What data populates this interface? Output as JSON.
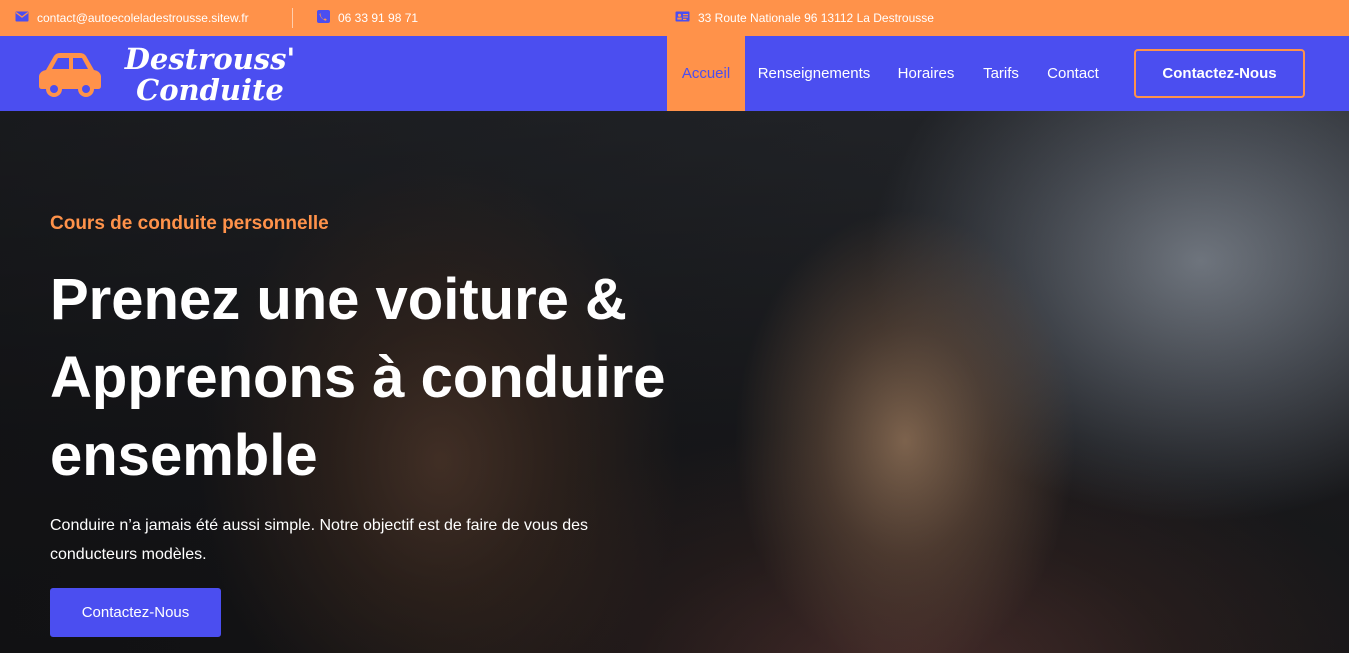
{
  "colors": {
    "accent_orange": "#FF924A",
    "brand_blue": "#4B4EF0"
  },
  "topbar": {
    "email": "contact@autoecoleladestrousse.sitew.fr",
    "email_icon": "mail-icon",
    "phone": "06 33 91 98 71",
    "phone_icon": "phone-icon",
    "address": "33 Route Nationale 96 13112 La Destrousse",
    "address_icon": "address-card-icon"
  },
  "logo": {
    "line1": "Destrouss'",
    "line2": "Conduite",
    "icon": "car-icon"
  },
  "nav": {
    "items": [
      {
        "label": "Accueil",
        "active": true
      },
      {
        "label": "Renseignements",
        "active": false
      },
      {
        "label": "Horaires",
        "active": false
      },
      {
        "label": "Tarifs",
        "active": false
      },
      {
        "label": "Contact",
        "active": false
      }
    ],
    "cta_label": "Contactez-Nous"
  },
  "hero": {
    "kicker": "Cours de conduite personnelle",
    "title_line1": "Prenez une voiture &",
    "title_line2": "Apprenons à conduire",
    "title_line3": "ensemble",
    "description": "Conduire n’a jamais été aussi simple. Notre objectif est de faire de vous des conducteurs modèles.",
    "cta_label": "Contactez-Nous"
  }
}
